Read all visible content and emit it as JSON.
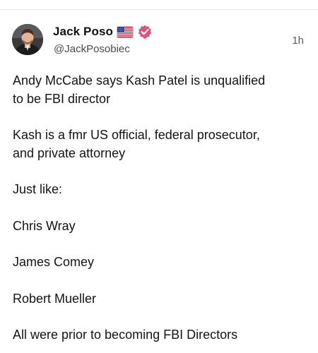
{
  "author": {
    "name": "Jack Poso",
    "handle": "@JackPosobiec",
    "flag_icon": "us-flag-icon",
    "verified_icon": "verified-badge-icon",
    "verified_color": "#e0507a"
  },
  "post": {
    "timestamp": "1h",
    "lines": [
      "Andy McCabe says Kash Patel is unqualified",
      "to be FBI director",
      "Kash is a fmr US official, federal prosecutor,",
      "and private attorney",
      "Just like:",
      "Chris Wray",
      "James Comey",
      "Robert Mueller",
      "All were prior to becoming FBI Directors"
    ]
  }
}
